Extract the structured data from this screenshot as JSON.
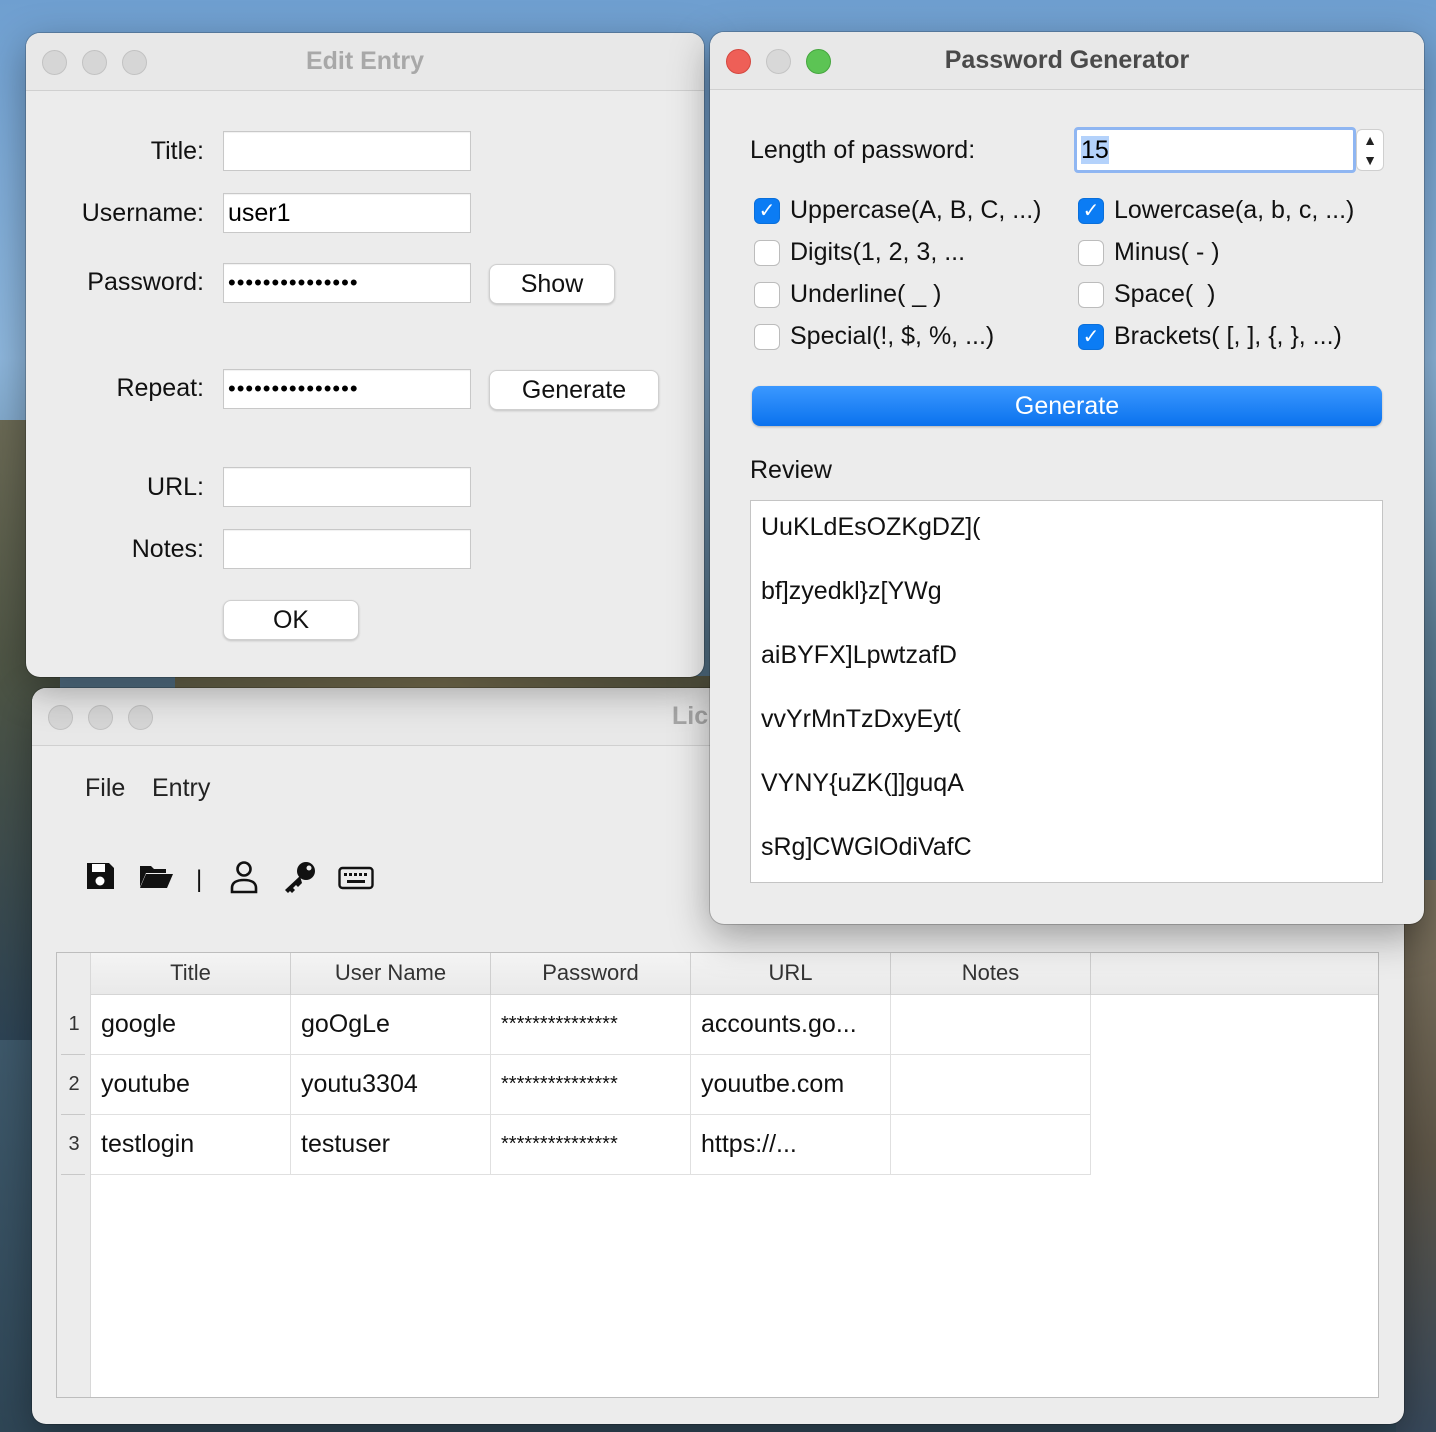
{
  "edit_entry": {
    "title": "Edit Entry",
    "labels": {
      "title": "Title:",
      "username": "Username:",
      "password": "Password:",
      "repeat": "Repeat:",
      "url": "URL:",
      "notes": "Notes:"
    },
    "values": {
      "title": "",
      "username": "user1",
      "password": "•••••••••••••••",
      "repeat": "•••••••••••••••",
      "url": "",
      "notes": ""
    },
    "buttons": {
      "show": "Show",
      "generate": "Generate",
      "ok": "OK"
    }
  },
  "password_generator": {
    "title": "Password Generator",
    "length_label": "Length of password:",
    "length_value": "15",
    "options": [
      {
        "label": "Uppercase(A, B, C, ...)",
        "checked": true
      },
      {
        "label": "Lowercase(a, b, c, ...)",
        "checked": true
      },
      {
        "label": "Digits(1, 2, 3, ...",
        "checked": false
      },
      {
        "label": "Minus( - )",
        "checked": false
      },
      {
        "label": "Underline( _ )",
        "checked": false
      },
      {
        "label": "Space(  )",
        "checked": false
      },
      {
        "label": "Special(!, $, %, ...)",
        "checked": false
      },
      {
        "label": "Brackets( [, ], {, }, ...)",
        "checked": true
      }
    ],
    "generate_label": "Generate",
    "review_label": "Review",
    "review_lines": [
      "UuKLdEsOZKgDZ](",
      "bf]zyedkl}z[YWg",
      "aiBYFX]LpwtzafD",
      "vvYrMnTzDxyEyt(",
      "VYNY{uZK(]]guqA",
      "sRg]CWGlOdiVafC"
    ]
  },
  "main_window": {
    "title_visible": "Lic",
    "menu": [
      "File",
      "Entry"
    ],
    "toolbar_icons": [
      "save-icon",
      "open-folder-icon",
      "separator",
      "user-icon",
      "key-icon",
      "keyboard-icon"
    ],
    "toolbar_separator": "|",
    "table": {
      "columns": [
        "Title",
        "User Name",
        "Password",
        "URL",
        "Notes"
      ],
      "rows": [
        {
          "num": "1",
          "title": "google",
          "username": "goOgLe",
          "password": "***************",
          "url": "accounts.go...",
          "notes": ""
        },
        {
          "num": "2",
          "title": "youtube",
          "username": "youtu3304",
          "password": "***************",
          "url": "youutbe.com",
          "notes": ""
        },
        {
          "num": "3",
          "title": "testlogin",
          "username": "testuser",
          "password": "***************",
          "url": "https://...",
          "notes": ""
        }
      ]
    }
  },
  "colors": {
    "accent": "#0b7cf4",
    "close": "#ee5f57",
    "zoom": "#5cc454"
  }
}
